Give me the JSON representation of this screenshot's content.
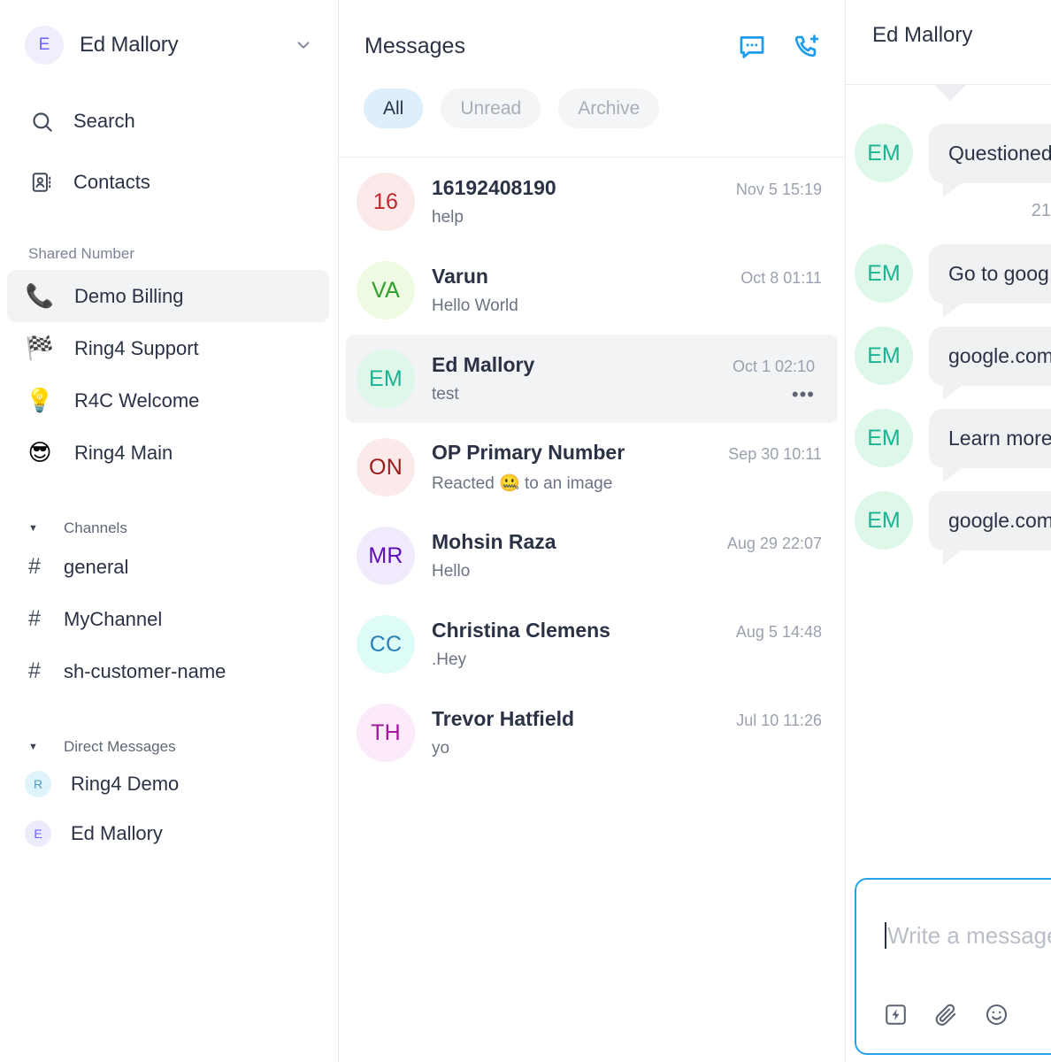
{
  "sidebar": {
    "account": {
      "initial": "E",
      "name": "Ed Mallory",
      "chevron_icon": "chevron-down-icon"
    },
    "nav": [
      {
        "label": "Search",
        "icon": "search-icon"
      },
      {
        "label": "Contacts",
        "icon": "contacts-book-icon"
      }
    ],
    "shared_number_label": "Shared Number",
    "shared_numbers": [
      {
        "emoji": "📞",
        "label": "Demo Billing",
        "selected": true
      },
      {
        "emoji": "🏁",
        "label": "Ring4 Support",
        "selected": false
      },
      {
        "emoji": "💡",
        "label": "R4C Welcome",
        "selected": false
      },
      {
        "emoji": "😎",
        "label": "Ring4 Main",
        "selected": false
      }
    ],
    "channels_label": "Channels",
    "channels": [
      {
        "label": "general"
      },
      {
        "label": "MyChannel"
      },
      {
        "label": "sh-customer-name"
      }
    ],
    "dm_label": "Direct Messages",
    "dms": [
      {
        "initial": "R",
        "label": "Ring4 Demo",
        "bg": "#dff3fa",
        "fg": "#4a9fc4"
      },
      {
        "initial": "E",
        "label": "Ed Mallory",
        "bg": "#ecebfb",
        "fg": "#6c63ff"
      }
    ]
  },
  "messages_panel": {
    "title": "Messages",
    "actions": [
      {
        "name": "new-message-icon"
      },
      {
        "name": "new-call-icon"
      }
    ],
    "tabs": [
      {
        "label": "All",
        "active": true
      },
      {
        "label": "Unread",
        "active": false
      },
      {
        "label": "Archive",
        "active": false
      }
    ],
    "conversations": [
      {
        "initials": "16",
        "name": "16192408190",
        "preview": "help",
        "time": "Nov 5 15:19",
        "bg": "#fce9ea",
        "fg": "#c0272d",
        "selected": false,
        "menu": false
      },
      {
        "initials": "VA",
        "name": "Varun",
        "preview": "Hello World",
        "time": "Oct 8 01:11",
        "bg": "#eefbe2",
        "fg": "#2e9e2e",
        "selected": false,
        "menu": false
      },
      {
        "initials": "EM",
        "name": "Ed Mallory",
        "preview": "test",
        "time": "Oct 1 02:10",
        "bg": "#ddf7e9",
        "fg": "#1ab394",
        "selected": true,
        "menu": true,
        "menu_label": "•••"
      },
      {
        "initials": "ON",
        "name": "OP Primary Number",
        "preview": "Reacted 🤐 to an image",
        "time": "Sep 30 10:11",
        "bg": "#fce9ea",
        "fg": "#9b1b1b",
        "selected": false,
        "menu": false
      },
      {
        "initials": "MR",
        "name": "Mohsin Raza",
        "preview": "Hello",
        "time": "Aug 29 22:07",
        "bg": "#f2ebfd",
        "fg": "#5b0fb5",
        "selected": false,
        "menu": false
      },
      {
        "initials": "CC",
        "name": "Christina Clemens",
        "preview": ".Hey",
        "time": "Aug 5 14:48",
        "bg": "#ddfbf7",
        "fg": "#2a81b5",
        "selected": false,
        "menu": false
      },
      {
        "initials": "TH",
        "name": "Trevor Hatfield",
        "preview": "yo",
        "time": "Jul 10 11:26",
        "bg": "#fceafb",
        "fg": "#a3159a",
        "selected": false,
        "menu": false
      }
    ]
  },
  "thread": {
    "title": "Ed Mallory",
    "timestamp": "21",
    "messages": [
      {
        "avatar": "EM",
        "text": "Questioned"
      },
      {
        "avatar": "EM",
        "text": "Go to goog"
      },
      {
        "avatar": "EM",
        "text": "google.com"
      },
      {
        "avatar": "EM",
        "text": "Learn more"
      },
      {
        "avatar": "EM",
        "text": "google.com"
      }
    ],
    "composer": {
      "placeholder": "Write a message",
      "tools": [
        {
          "name": "quick-reply-icon"
        },
        {
          "name": "attachment-icon"
        },
        {
          "name": "emoji-icon"
        }
      ]
    }
  },
  "colors": {
    "accent_blue": "#1c9bef",
    "composer_border": "#24a3ef",
    "text_primary": "#2b3245",
    "text_muted": "#9aa1ae",
    "bubble_bg": "#f0f1f3",
    "selected_bg": "#f2f3f5",
    "tab_active_bg": "#ddeefc"
  }
}
